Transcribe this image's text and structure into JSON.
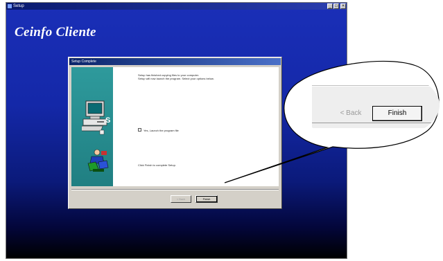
{
  "outer_window": {
    "title": "Setup",
    "heading": "Ceinfo Cliente",
    "controls": [
      "_",
      "□",
      "×"
    ]
  },
  "dialog": {
    "title": "Setup Complete",
    "intro_line1": "Setup has finished copying files to your computer.",
    "intro_line2": "Setup will now launch the program. Select your options below.",
    "checkbox_label": "Yes, Launch the program file",
    "finish_instruction": "Click Finish to complete Setup.",
    "back_button": "< Back",
    "finish_button": "Finish"
  },
  "callout": {
    "back_label": "< Back",
    "finish_label": "Finish"
  },
  "colors": {
    "background_top": "#1a2fb8",
    "background_bottom": "#000000",
    "side_panel": "#2e9a9c",
    "dialog_face": "#d4d0c8"
  },
  "icons": [
    "computer-setup-icon",
    "install-figure-icon"
  ]
}
